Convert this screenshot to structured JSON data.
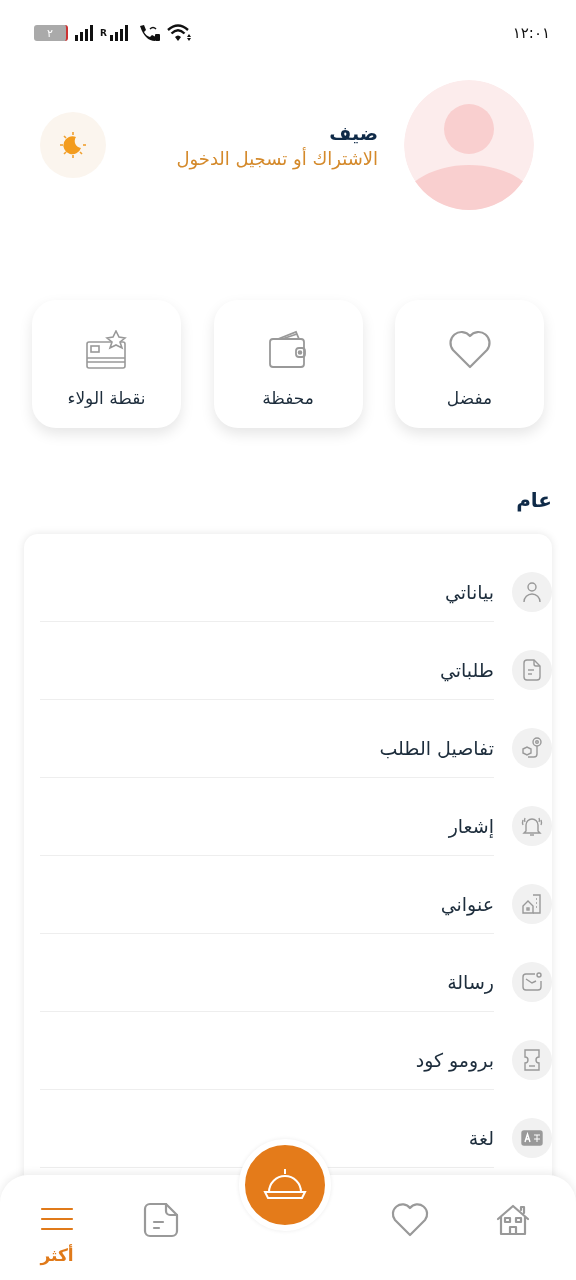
{
  "status_bar": {
    "time": "١٢:٠١",
    "battery": "٢",
    "network_label": "R"
  },
  "profile": {
    "name": "ضيف",
    "subtitle": "الاشتراك أو تسجيل الدخول"
  },
  "quick_actions": [
    {
      "kind": "heart",
      "label": "مفضل"
    },
    {
      "kind": "wallet",
      "label": "محفظة"
    },
    {
      "kind": "loyalty",
      "label": "نقطة الولاء"
    }
  ],
  "section_title": "عام",
  "menu": [
    {
      "kind": "person",
      "label": "بياناتي"
    },
    {
      "kind": "document",
      "label": "طلباتي"
    },
    {
      "kind": "tracking",
      "label": "تفاصيل الطلب"
    },
    {
      "kind": "bell",
      "label": "إشعار"
    },
    {
      "kind": "address",
      "label": "عنواني"
    },
    {
      "kind": "message",
      "label": "رسالة"
    },
    {
      "kind": "ticket",
      "label": "برومو كود"
    },
    {
      "kind": "language",
      "label": "لغة"
    }
  ],
  "bottom_nav": [
    {
      "kind": "home",
      "selected": false
    },
    {
      "kind": "heart",
      "selected": false
    },
    {
      "kind": "dish",
      "selected": false
    },
    {
      "kind": "document",
      "selected": false
    },
    {
      "kind": "menu",
      "selected": true,
      "label": "أكثر"
    }
  ]
}
